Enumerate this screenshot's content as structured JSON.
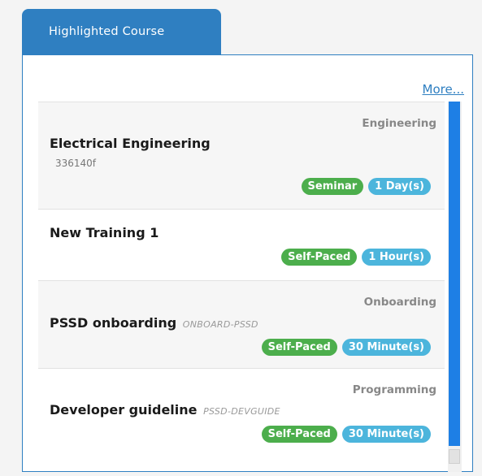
{
  "widget": {
    "tab_label": "Highlighted Course",
    "more_label": "More...",
    "courses": [
      {
        "title": "Electrical Engineering",
        "code": "336140f",
        "category": "Engineering",
        "type_badge": "Seminar",
        "duration_badge": "1 Day(s)"
      },
      {
        "title": "New Training 1",
        "code": "",
        "category": "",
        "type_badge": "Self-Paced",
        "duration_badge": "1 Hour(s)"
      },
      {
        "title": "PSSD onboarding",
        "code": "ONBOARD-PSSD",
        "category": "Onboarding",
        "type_badge": "Self-Paced",
        "duration_badge": "30 Minute(s)"
      },
      {
        "title": "Developer guideline",
        "code": "PSSD-DEVGUIDE",
        "category": "Programming",
        "type_badge": "Self-Paced",
        "duration_badge": "30 Minute(s)"
      }
    ]
  },
  "colors": {
    "tab_blue": "#2f7fc1",
    "badge_green": "#4cae4c",
    "badge_blue": "#4cb5dc",
    "scrollbar_thumb": "#1e7fe5"
  }
}
